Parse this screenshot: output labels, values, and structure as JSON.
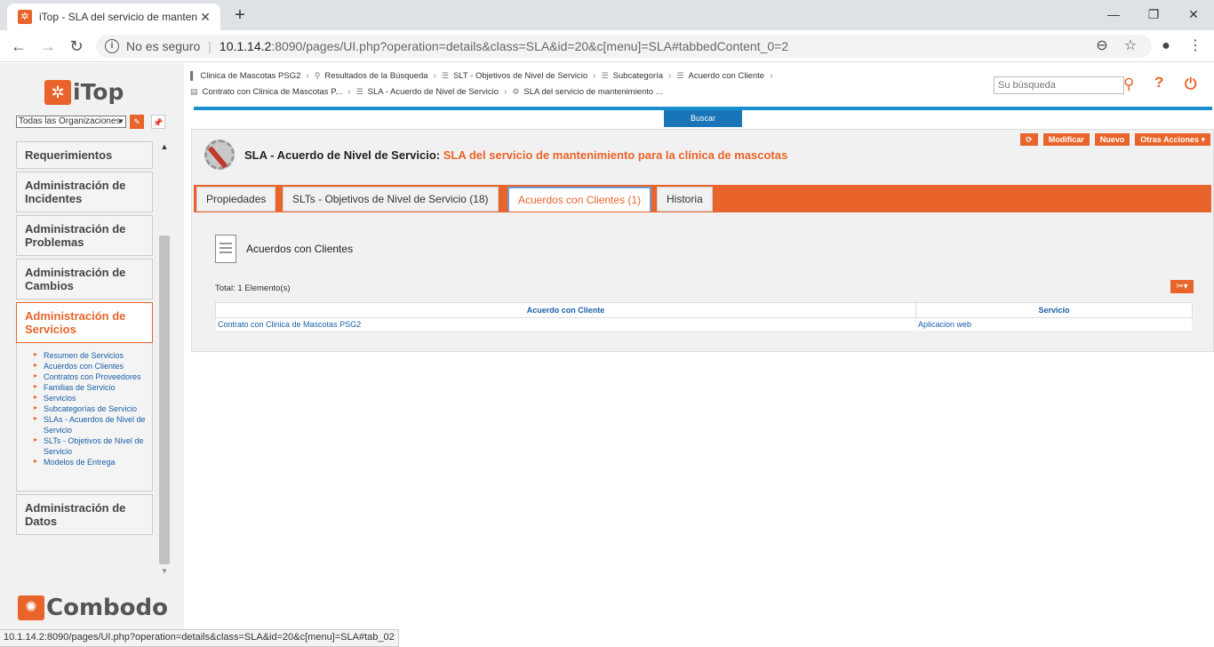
{
  "browser": {
    "tab_title": "iTop - SLA del servicio de mantenimiento para la clínica de mascotas",
    "new_tab": "+",
    "minimize": "—",
    "restore": "❐",
    "close": "✕",
    "security_label": "No es seguro",
    "url_host": "10.1.14.2",
    "url_rest": ":8090/pages/UI.php?operation=details&class=SLA&id=20&c[menu]=SLA#tabbedContent_0=2",
    "status_url": "10.1.14.2:8090/pages/UI.php?operation=details&class=SLA&id=20&c[menu]=SLA#tab_02"
  },
  "app": {
    "logo_text": "iTop",
    "org_select": "Todas las Organizaciones",
    "search_placeholder": "Su búsqueda",
    "buscar_label": "Buscar",
    "footer_brand": "Combodo"
  },
  "breadcrumbs": {
    "row1": [
      {
        "label": "Clinica de Mascotas PSG2",
        "icon": "bar-icon"
      },
      {
        "label": "Resultados de la Búsqueda",
        "icon": "search-icon"
      },
      {
        "label": "SLT - Objetivos de Nivel de Servicio",
        "icon": "list-icon"
      },
      {
        "label": "Subcategoría",
        "icon": "list-icon"
      },
      {
        "label": "Acuerdo con Cliente",
        "icon": "list-icon"
      }
    ],
    "row2": [
      {
        "label": "Contrato con Clinica de Mascotas P...",
        "icon": "doc-icon"
      },
      {
        "label": "SLA - Acuerdo de Nivel de Servicio",
        "icon": "list-icon"
      },
      {
        "label": "SLA del servicio de mantenimiento ...",
        "icon": "gear-icon"
      }
    ]
  },
  "menu": {
    "groups": [
      {
        "label": "Requerimientos"
      },
      {
        "label": "Administración de Incidentes"
      },
      {
        "label": "Administración de Problemas"
      },
      {
        "label": "Administración de Cambios"
      },
      {
        "label": "Administración de Servicios"
      },
      {
        "label": "Administración de Datos"
      }
    ],
    "services_items": [
      "Resumen de Servicios",
      "Acuerdos con Clientes",
      "Contratos con Proveedores",
      "Familias de Servicio",
      "Servicios",
      "Subcategorías de Servicio",
      "SLAs - Acuerdos de Nivel de Servicio",
      "SLTs - Objetivos de Nivel de Servicio",
      "Modelos de Entrega"
    ]
  },
  "object": {
    "class_label": "SLA - Acuerdo de Nivel de Servicio:",
    "name": "SLA del servicio de mantenimiento para la clínica de mascotas",
    "actions": {
      "refresh": "⟳",
      "modify": "Modificar",
      "new": "Nuevo",
      "other": "Otras Acciones ▾"
    },
    "tabs": [
      {
        "label": "Propiedades"
      },
      {
        "label": "SLTs - Objetivos de Nivel de Servicio (18)"
      },
      {
        "label": "Acuerdos con Clientes (1)"
      },
      {
        "label": "Historia"
      }
    ]
  },
  "panel": {
    "title": "Acuerdos con Clientes",
    "total": "Total: 1 Elemento(s)",
    "columns": [
      "Acuerdo con Cliente",
      "Servicio"
    ],
    "rows": [
      [
        "Contrato con Clinica de Mascotas PSG2",
        "Aplicacion web"
      ]
    ]
  },
  "colors": {
    "accent": "#e8642a",
    "link": "#1a5fa8",
    "header_bar": "#1a8fd0"
  }
}
